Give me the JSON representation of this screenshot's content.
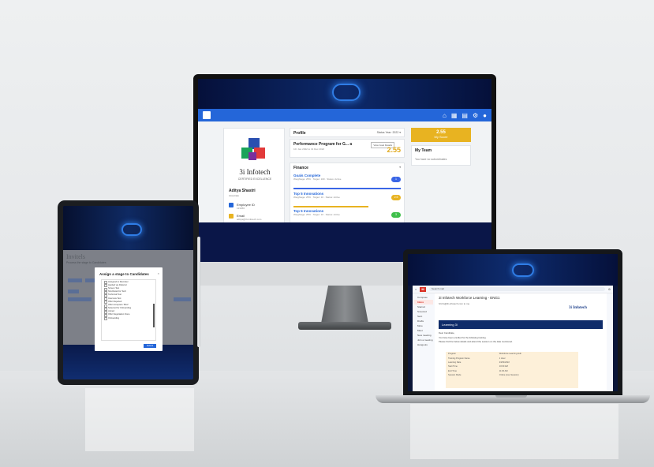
{
  "monitor": {
    "nav_icons": [
      "home-icon",
      "grid-icon",
      "apps-icon",
      "user-icon",
      "bell-icon"
    ],
    "profile": {
      "brand": "3i Infotech",
      "brand_sub": "CERTIFIED EXCELLENCE",
      "name": "Aditya Shastri",
      "name_sub": "Associate",
      "rows": [
        {
          "label": "Employee ID",
          "value": "123456"
        },
        {
          "label": "Email",
          "value": "aditya@3i-infotech.com"
        }
      ]
    },
    "profile_panel": {
      "title": "Profile",
      "filter": "Status Year: 2022 ▾"
    },
    "performance": {
      "title": "Performance Program for G... a",
      "sub": "1D: Jan 2022 to 31 Dec 2022",
      "button": "View Goal Details",
      "score": "2.55"
    },
    "finance": {
      "title": "Finance",
      "goals": [
        {
          "title": "Goals Complete",
          "meta": "Weightage: 25% · Target: 100 · Status: Active",
          "pill": "1",
          "color": "#3a66e6"
        },
        {
          "title": "Top 5 Innovations",
          "meta": "Weightage: 25% · Target: 10 · Status: Active",
          "pill": "2.5",
          "color": "#e8b321"
        },
        {
          "title": "Top 5 Innovations",
          "meta": "Weightage: 25% · Target: 10 · Status: Active",
          "pill": "3",
          "color": "#3fbf4b"
        }
      ]
    },
    "score_card": {
      "value": "2.55",
      "label": "My Score"
    },
    "team": {
      "title": "My Team",
      "note": "You have no subordinates"
    }
  },
  "tablet": {
    "ghost_title": "Invitels",
    "ghost_sub": "Process the stage to Candidates",
    "modal": {
      "title": "Assign a stage to Candidates",
      "items": [
        "Assigned to Recruiter",
        "Applied via Referral",
        "Screen Test",
        "Shortlisted for Tech",
        "Technical Test",
        "Interview Test",
        "Offer Rejected",
        "Offer Accepted / BGV",
        "Selected for Onboarding",
        "Joined",
        "Offer Negotiation Done",
        "Onboarding"
      ],
      "button": "Submit"
    }
  },
  "laptop": {
    "gmail": {
      "search": "Search mail",
      "nav": [
        "Compose",
        "Inbox",
        "Starred",
        "Snoozed",
        "Sent",
        "Drafts",
        "More",
        "Meet",
        "New meeting",
        "Join a meeting",
        "Hangouts"
      ],
      "subject": "3i Infotech Workforce Learning - ENG1",
      "from": "hrinfo@3i-infotech.com to me",
      "logo": "3i Infotech",
      "banner": "Learning 3i",
      "text": [
        "Dear Candidate,",
        "You have been enrolled for the following training.",
        "Please find the below details and attend the session on the date mentioned."
      ],
      "table": [
        [
          "Program",
          "Workforce Learning Hub"
        ],
        [
          "Training Program Name",
          "1 Hour"
        ],
        [
          "Learning Date",
          "23/04/2022"
        ],
        [
          "Start Time",
          "10:00 AM"
        ],
        [
          "End Time",
          "11:00 AM"
        ],
        [
          "Session Mode",
          "Online (Live Session)"
        ]
      ]
    }
  }
}
